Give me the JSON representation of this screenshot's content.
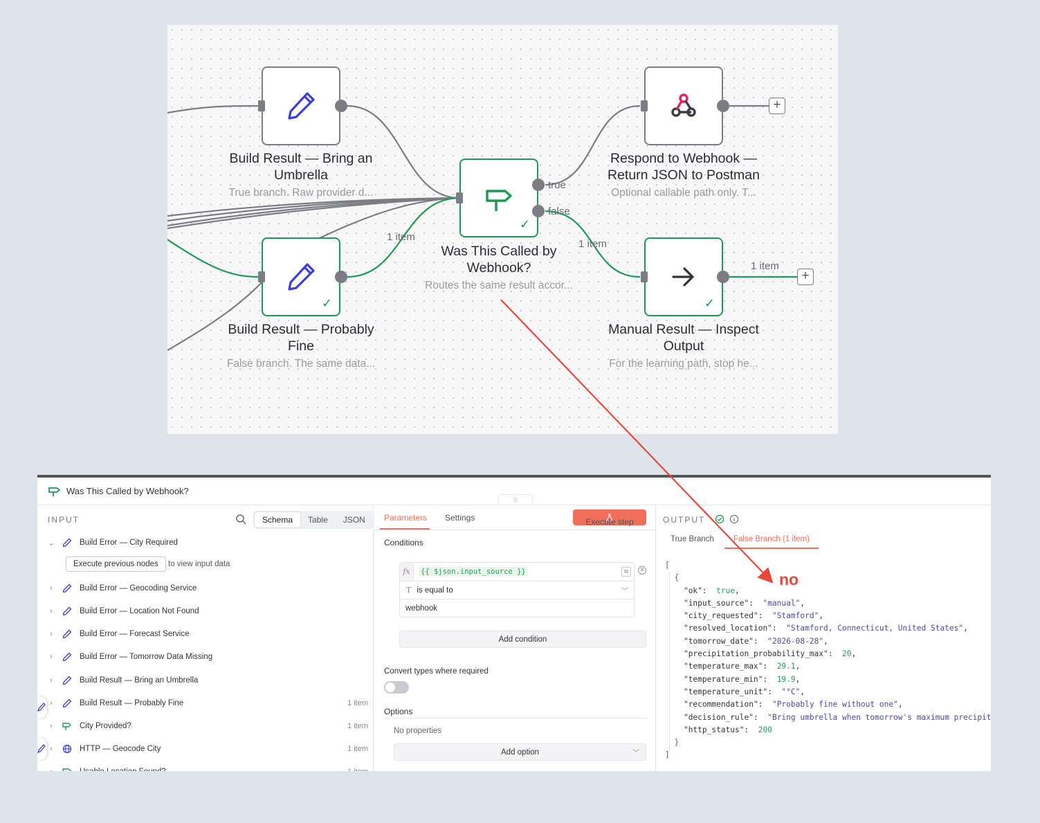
{
  "canvas": {
    "nodes": {
      "umbrella": {
        "title": "Build Result — Bring an Umbrella",
        "subtitle": "True branch. Raw provider d..."
      },
      "fine": {
        "title": "Build Result — Probably Fine",
        "subtitle": "False branch. The same data..."
      },
      "if": {
        "title": "Was This Called by Webhook?",
        "subtitle": "Routes the same result accor..."
      },
      "respond": {
        "title": "Respond to Webhook — Return JSON to Postman",
        "subtitle": "Optional callable path only. T..."
      },
      "manual": {
        "title": "Manual Result — Inspect Output",
        "subtitle": "For the learning path, stop he..."
      }
    },
    "edge_labels": {
      "true": "true",
      "false": "false",
      "fine_items": "1 item",
      "false_items": "1 item",
      "manual_items": "1 item"
    },
    "colors": {
      "success": "#1b9a55",
      "default_edge": "#7c7c84",
      "accent": "#ef6f5a"
    }
  },
  "panel": {
    "title": "Was This Called by Webhook?",
    "input": {
      "label": "INPUT",
      "views": [
        "Schema",
        "Table",
        "JSON"
      ],
      "active_view": "Schema",
      "execute_previous": "Execute previous nodes",
      "execute_previous_hint": "to view input data",
      "items": [
        {
          "name": "Build Error — City Required",
          "count": "",
          "icon": "pencil-icon",
          "expanded": true
        },
        {
          "name": "Build Error — Geocoding Service",
          "count": "",
          "icon": "pencil-icon"
        },
        {
          "name": "Build Error — Location Not Found",
          "count": "",
          "icon": "pencil-icon"
        },
        {
          "name": "Build Error — Forecast Service",
          "count": "",
          "icon": "pencil-icon"
        },
        {
          "name": "Build Error — Tomorrow Data Missing",
          "count": "",
          "icon": "pencil-icon"
        },
        {
          "name": "Build Result — Bring an Umbrella",
          "count": "",
          "icon": "pencil-icon"
        },
        {
          "name": "Build Result — Probably Fine",
          "count": "1 item",
          "icon": "pencil-icon"
        },
        {
          "name": "City Provided?",
          "count": "1 item",
          "icon": "signpost-icon"
        },
        {
          "name": "HTTP — Geocode City",
          "count": "1 item",
          "icon": "globe-icon"
        },
        {
          "name": "Usable Location Found?",
          "count": "1 item",
          "icon": "signpost-icon"
        }
      ]
    },
    "params": {
      "tabs": [
        "Parameters",
        "Settings"
      ],
      "execute_step": "Execute step",
      "conditions_label": "Conditions",
      "condition": {
        "left": "{{ $json.input_source }}",
        "operator": "is equal to",
        "right": "webhook"
      },
      "add_condition": "Add condition",
      "convert_types": "Convert types where required",
      "options_label": "Options",
      "no_properties": "No properties",
      "add_option": "Add option"
    },
    "output": {
      "label": "OUTPUT",
      "tabs": [
        "True Branch",
        "False Branch (1 item)"
      ],
      "active_tab": "False Branch (1 item)"
    }
  },
  "annotation": {
    "text": "no",
    "color": "#e8473c"
  }
}
